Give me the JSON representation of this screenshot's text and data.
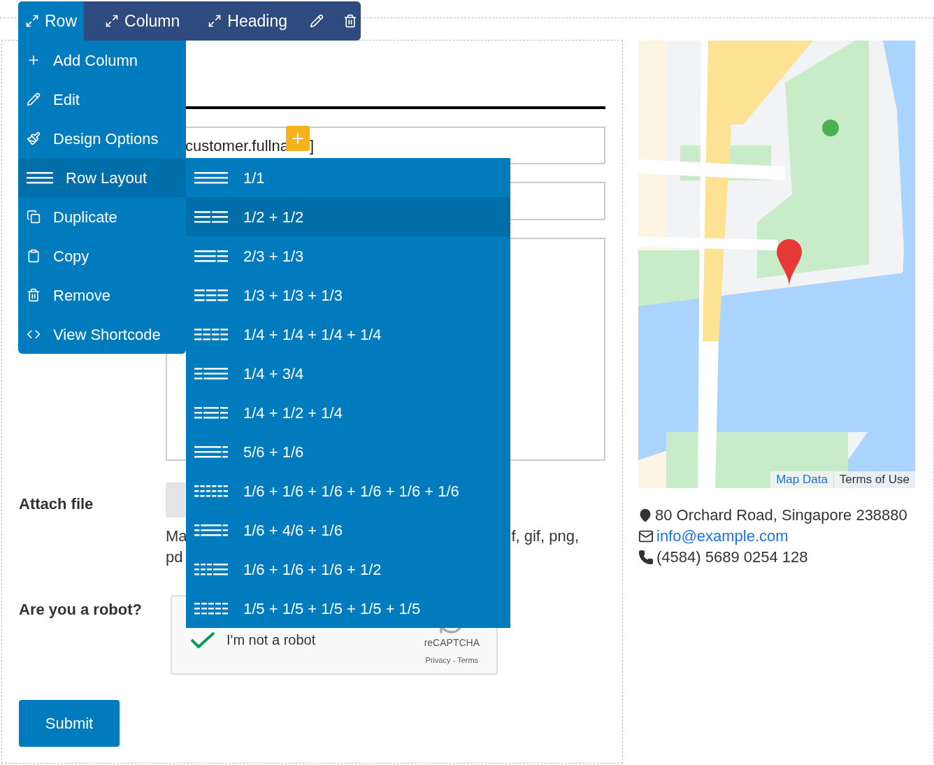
{
  "toolbar": {
    "breadcrumbs": [
      {
        "label": "Row",
        "selected": true
      },
      {
        "label": "Column",
        "selected": false
      },
      {
        "label": "Heading",
        "selected": false
      }
    ]
  },
  "menu": {
    "items": [
      {
        "kind": "add",
        "label": "Add Column",
        "selected": false
      },
      {
        "kind": "edit",
        "label": "Edit",
        "selected": false
      },
      {
        "kind": "design",
        "label": "Design Options",
        "selected": false
      },
      {
        "kind": "layout",
        "label": "Row Layout",
        "selected": true
      },
      {
        "kind": "duplicate",
        "label": "Duplicate",
        "selected": false
      },
      {
        "kind": "copy",
        "label": "Copy",
        "selected": false
      },
      {
        "kind": "remove",
        "label": "Remove",
        "selected": false
      },
      {
        "kind": "shortcode",
        "label": "View Shortcode",
        "selected": false
      }
    ]
  },
  "layouts": [
    {
      "label": "1/1",
      "selected": false
    },
    {
      "label": "1/2 + 1/2",
      "selected": true
    },
    {
      "label": "2/3 + 1/3",
      "selected": false
    },
    {
      "label": "1/3 + 1/3 + 1/3",
      "selected": false
    },
    {
      "label": "1/4 + 1/4 + 1/4 + 1/4",
      "selected": false
    },
    {
      "label": "1/4 + 3/4",
      "selected": false
    },
    {
      "label": "1/4 + 1/2 + 1/4",
      "selected": false
    },
    {
      "label": "5/6 + 1/6",
      "selected": false
    },
    {
      "label": "1/6 + 1/6 + 1/6 + 1/6 + 1/6 + 1/6",
      "selected": false
    },
    {
      "label": "1/6 + 4/6 + 1/6",
      "selected": false
    },
    {
      "label": "1/6 + 1/6 + 1/6 + 1/2",
      "selected": false
    },
    {
      "label": "1/5 + 1/5 + 1/5 + 1/5 + 1/5",
      "selected": false
    }
  ],
  "form": {
    "name_field": {
      "value_start": "customer.fullna",
      "value_end": "]"
    },
    "attach": {
      "label": "Attach file",
      "help_start": "Ma",
      "help_end": "f, gif, png,",
      "help_line2": "pd"
    },
    "robot": {
      "label": "Are you a robot?",
      "checked": true,
      "text": "I'm not a robot",
      "brand": "reCAPTCHA",
      "links": "Privacy - Terms"
    },
    "submit": "Submit"
  },
  "map": {
    "kind": "picture",
    "links": [
      "Map Data",
      "Terms of Use"
    ]
  },
  "contact": {
    "address": "80 Orchard Road, Singapore 238880",
    "email": "info@example.com",
    "phone": "(4584) 5689 0254 128"
  }
}
